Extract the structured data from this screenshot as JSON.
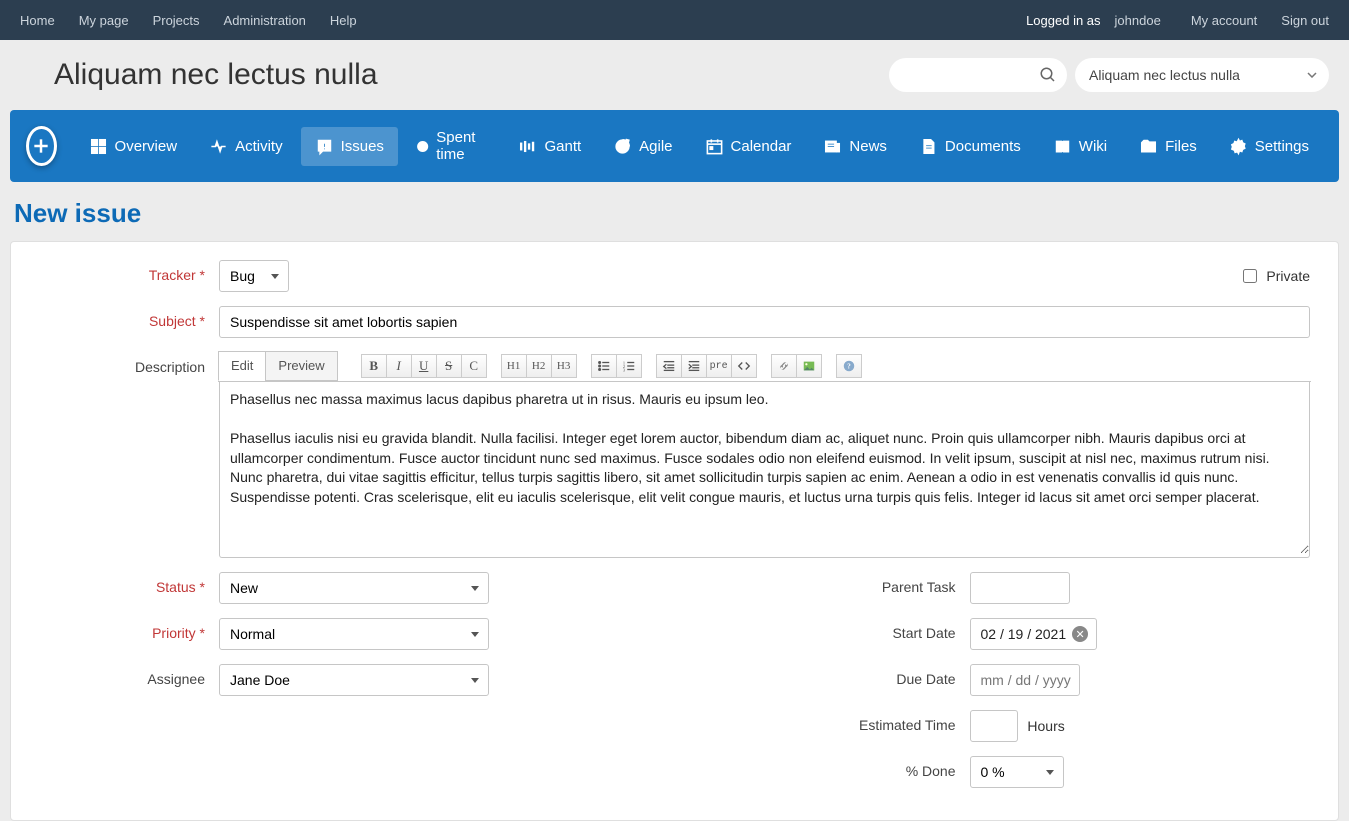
{
  "topbar": {
    "left": [
      "Home",
      "My page",
      "Projects",
      "Administration",
      "Help"
    ],
    "logged_label": "Logged in as",
    "username": "johndoe",
    "right": [
      "My account",
      "Sign out"
    ]
  },
  "header": {
    "project_title": "Aliquam nec lectus nulla",
    "project_select_value": "Aliquam nec lectus nulla",
    "search_placeholder": ""
  },
  "navbar": {
    "tabs": [
      "Overview",
      "Activity",
      "Issues",
      "Spent time",
      "Gantt",
      "Agile",
      "Calendar",
      "News",
      "Documents",
      "Wiki",
      "Files",
      "Settings"
    ],
    "active": "Issues"
  },
  "page": {
    "title": "New issue"
  },
  "form": {
    "labels": {
      "tracker": "Tracker",
      "subject": "Subject",
      "description": "Description",
      "status": "Status",
      "priority": "Priority",
      "assignee": "Assignee",
      "parent_task": "Parent Task",
      "start_date": "Start Date",
      "due_date": "Due Date",
      "est_time": "Estimated Time",
      "done": "% Done",
      "private": "Private",
      "hours": "Hours"
    },
    "values": {
      "tracker": "Bug",
      "subject": "Suspendisse sit amet lobortis sapien",
      "description": "Phasellus nec massa maximus lacus dapibus pharetra ut in risus. Mauris eu ipsum leo.\n\nPhasellus iaculis nisi eu gravida blandit. Nulla facilisi. Integer eget lorem auctor, bibendum diam ac, aliquet nunc. Proin quis ullamcorper nibh. Mauris dapibus orci at ullamcorper condimentum. Fusce auctor tincidunt nunc sed maximus. Fusce sodales odio non eleifend euismod. In velit ipsum, suscipit at nisl nec, maximus rutrum nisi. Nunc pharetra, dui vitae sagittis efficitur, tellus turpis sagittis libero, sit amet sollicitudin turpis sapien ac enim. Aenean a odio in est venenatis convallis id quis nunc. Suspendisse potenti. Cras scelerisque, elit eu iaculis scelerisque, elit velit congue mauris, et luctus urna turpis quis felis. Integer id lacus sit amet orci semper placerat.",
      "status": "New",
      "priority": "Normal",
      "assignee": "Jane Doe",
      "parent_task": "",
      "start_date": "02 / 19 / 2021",
      "due_date_placeholder": "mm / dd / yyyy",
      "est_time": "",
      "done": "0 %"
    },
    "editor_tabs": {
      "edit": "Edit",
      "preview": "Preview"
    },
    "toolbar_h": {
      "h1": "H1",
      "h2": "H2",
      "h3": "H3",
      "pre": "pre"
    }
  }
}
